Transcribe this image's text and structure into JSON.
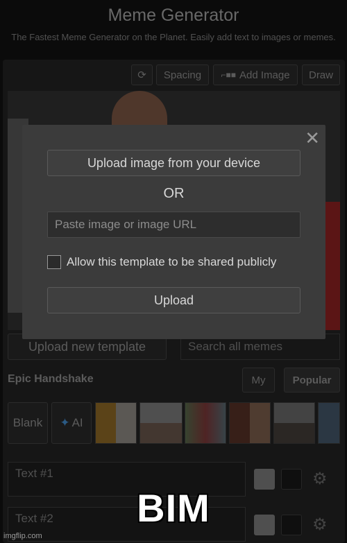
{
  "header": {
    "title": "Meme Generator",
    "subtitle": "The Fastest Meme Generator on the Planet. Easily add text to images or memes."
  },
  "toolbar": {
    "rotate_icon": "rotate-icon",
    "spacing_label": "Spacing",
    "add_image_icon": "glasses-icon",
    "add_image_label": "Add Image",
    "draw_label": "Draw"
  },
  "modal": {
    "upload_device_label": "Upload image from your device",
    "or_label": "OR",
    "url_placeholder": "Paste image or image URL",
    "share_checkbox_label": "Allow this template to be shared publicly",
    "upload_label": "Upload",
    "close_glyph": "✕"
  },
  "templates": {
    "upload_new_label": "Upload new template",
    "search_placeholder": "Search all memes",
    "current_template": "Epic Handshake",
    "tab_my": "My",
    "tab_popular": "Popular",
    "blank_label": "Blank",
    "ai_label": "AI"
  },
  "text_boxes": [
    {
      "placeholder": "Text #1"
    },
    {
      "placeholder": "Text #2"
    }
  ],
  "caption": "BIM",
  "watermark": "imgflip.com",
  "colors": {
    "background": "#0f0f0f",
    "modal": "#3b3b3b",
    "ai_accent": "#4aa3ff"
  }
}
